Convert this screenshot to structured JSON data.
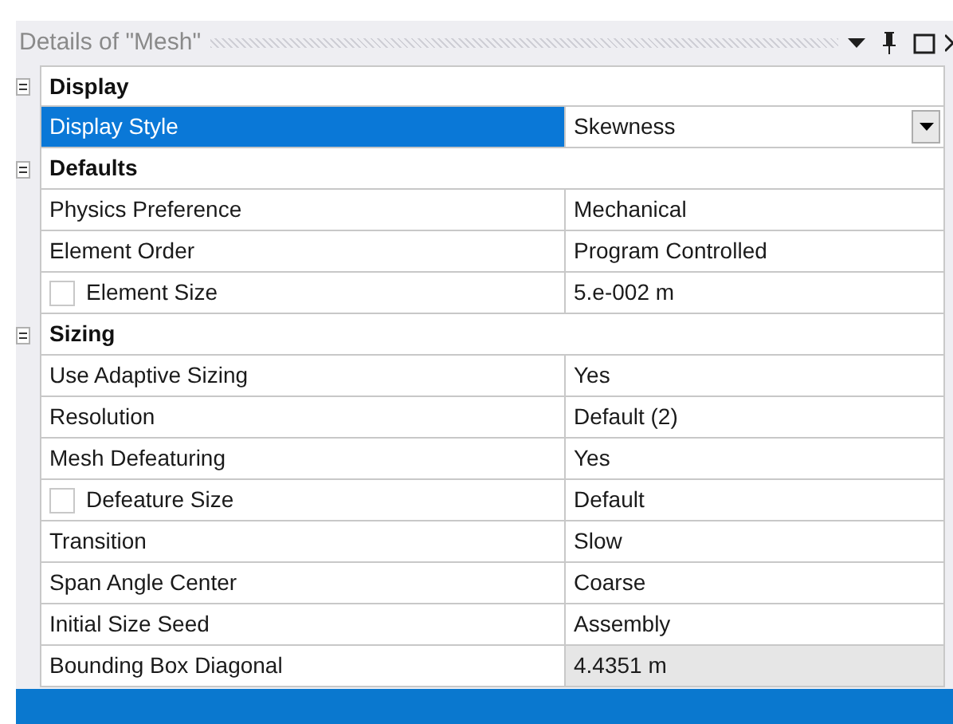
{
  "panel": {
    "title": "Details of \"Mesh\""
  },
  "sections": [
    {
      "title": "Display",
      "expanded": true,
      "rows": [
        {
          "label": "Display Style",
          "value": "Skewness",
          "kind": "dropdown",
          "selected": true,
          "read_only": false
        }
      ]
    },
    {
      "title": "Defaults",
      "expanded": true,
      "rows": [
        {
          "label": "Physics Preference",
          "value": "Mechanical",
          "kind": "plain",
          "selected": false,
          "read_only": false
        },
        {
          "label": "Element Order",
          "value": "Program Controlled",
          "kind": "plain",
          "selected": false,
          "read_only": false
        },
        {
          "label": "Element Size",
          "value": "5.e-002 m",
          "kind": "checkbox",
          "checked": false,
          "selected": false,
          "read_only": false
        }
      ]
    },
    {
      "title": "Sizing",
      "expanded": true,
      "rows": [
        {
          "label": "Use Adaptive Sizing",
          "value": "Yes",
          "kind": "plain",
          "selected": false,
          "read_only": false
        },
        {
          "label": "Resolution",
          "value": "Default (2)",
          "kind": "plain",
          "selected": false,
          "read_only": false
        },
        {
          "label": "Mesh Defeaturing",
          "value": "Yes",
          "kind": "plain",
          "selected": false,
          "read_only": false
        },
        {
          "label": "Defeature Size",
          "value": "Default",
          "kind": "checkbox",
          "checked": false,
          "selected": false,
          "read_only": false
        },
        {
          "label": "Transition",
          "value": "Slow",
          "kind": "plain",
          "selected": false,
          "read_only": false
        },
        {
          "label": "Span Angle Center",
          "value": "Coarse",
          "kind": "plain",
          "selected": false,
          "read_only": false
        },
        {
          "label": "Initial Size Seed",
          "value": "Assembly",
          "kind": "plain",
          "selected": false,
          "read_only": false
        },
        {
          "label": "Bounding Box Diagonal",
          "value": "4.4351 m",
          "kind": "plain",
          "selected": false,
          "read_only": true
        }
      ]
    }
  ]
}
